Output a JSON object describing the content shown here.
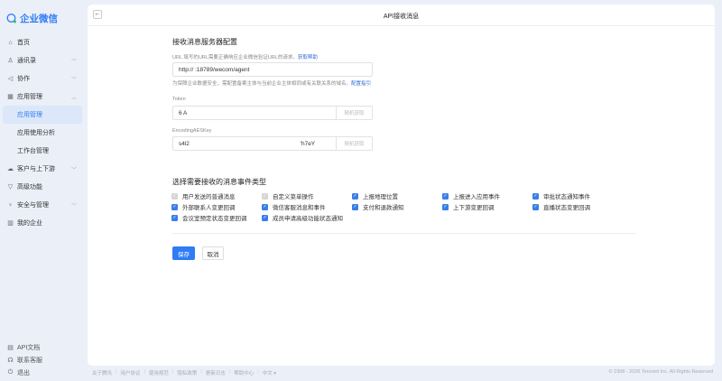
{
  "app": {
    "logo_text": "企业微信"
  },
  "sidebar": {
    "items": [
      {
        "label": "首页",
        "icon": "home-icon"
      },
      {
        "label": "通讯录",
        "icon": "contacts-icon",
        "chevron": "﹀"
      },
      {
        "label": "协作",
        "icon": "collab-icon",
        "chevron": "﹀"
      },
      {
        "label": "应用管理",
        "icon": "apps-icon",
        "chevron": "︿"
      },
      {
        "label": "应用管理",
        "sub": true,
        "active": true
      },
      {
        "label": "应用使用分析",
        "sub": true
      },
      {
        "label": "工作台管理",
        "sub": true
      },
      {
        "label": "客户与上下游",
        "icon": "customer-icon",
        "chevron": "﹀"
      },
      {
        "label": "高级功能",
        "icon": "advanced-icon"
      },
      {
        "label": "安全与管理",
        "icon": "security-icon",
        "chevron": "﹀"
      },
      {
        "label": "我的企业",
        "icon": "company-icon"
      }
    ],
    "bottom": [
      {
        "label": "API文档"
      },
      {
        "label": "联系客服"
      },
      {
        "label": "退出"
      }
    ]
  },
  "page": {
    "title": "API接收消息",
    "back": "←"
  },
  "server": {
    "heading": "接收消息服务器配置",
    "url_label": "URL  填写的URL需要正确响应企业微信验证URL的请求。",
    "url_help": "获取帮助",
    "url_value": "http://                          :18789/wecom/agent",
    "note": "为保障企业数据安全，需配置备案主体与当前企业主体相同或有关联关系的域名。",
    "note_link": "配置指引",
    "token_label": "Token",
    "token_value": "6            A",
    "random_label": "随机获取",
    "aes_label": "EncodingAESKey",
    "aes_value": "s4l2                                                                    'h7eY"
  },
  "events": {
    "heading": "选择需要接收的消息事件类型",
    "items": [
      {
        "label": "用户发送的普通消息",
        "checked": true,
        "disabled": true
      },
      {
        "label": "自定义菜单操作",
        "checked": true,
        "disabled": true
      },
      {
        "label": "上报地理位置",
        "checked": true
      },
      {
        "label": "上报进入应用事件",
        "checked": true
      },
      {
        "label": "审批状态通知事件",
        "checked": true
      },
      {
        "label": "外部联系人变更回调",
        "checked": true
      },
      {
        "label": "微信客服消息和事件",
        "checked": true
      },
      {
        "label": "支付和退款通知",
        "checked": true
      },
      {
        "label": "上下游变更回调",
        "checked": true
      },
      {
        "label": "直播状态变更回调",
        "checked": true
      },
      {
        "label": "会议室预定状态变更回调",
        "checked": true
      },
      {
        "label": "成员申请高级功能状态通知",
        "checked": true
      }
    ]
  },
  "actions": {
    "save": "保存",
    "cancel": "取消"
  },
  "footer": {
    "links": [
      "关于腾讯",
      "用户协议",
      "使用规范",
      "隐私政策",
      "更新日志",
      "帮助中心",
      "中文 ▾"
    ],
    "copyright": "© 1998 - 2026 Tencent Inc. All Rights Reserved"
  },
  "colors": {
    "accent": "#2f7cf6",
    "bg": "#eaeff8"
  }
}
